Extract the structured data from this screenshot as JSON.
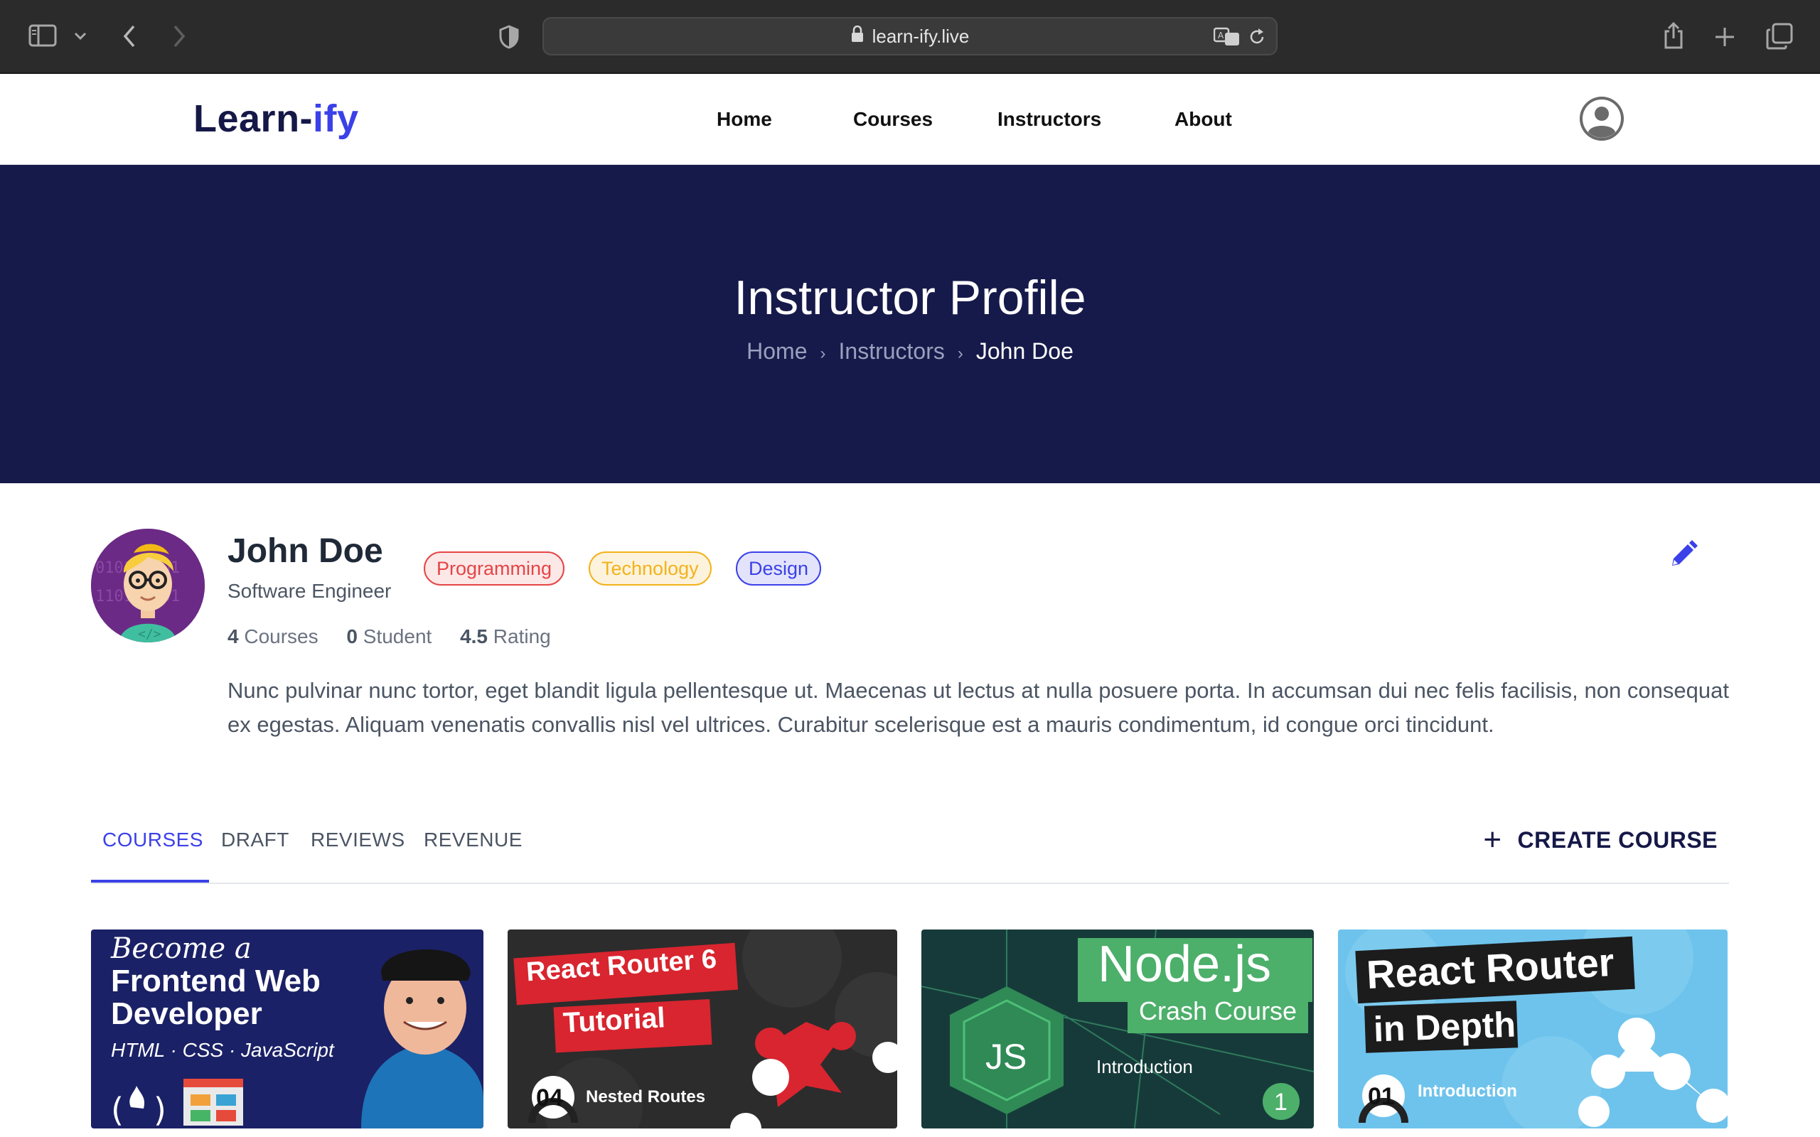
{
  "browser": {
    "url": "learn-ify.live"
  },
  "site": {
    "logo_main": "Learn-",
    "logo_accent": "ify",
    "nav": [
      "Home",
      "Courses",
      "Instructors",
      "About"
    ]
  },
  "hero": {
    "title": "Instructor Profile",
    "breadcrumb": [
      "Home",
      "Instructors",
      "John Doe"
    ]
  },
  "profile": {
    "name": "John Doe",
    "title": "Software Engineer",
    "tags": [
      {
        "label": "Programming",
        "color": "#e54545"
      },
      {
        "label": "Technology",
        "color": "#f2b21b"
      },
      {
        "label": "Design",
        "color": "#3b41e8"
      }
    ],
    "stats": {
      "courses_count": "4",
      "courses_label": "Courses",
      "students_count": "0",
      "students_label": "Student",
      "rating_value": "4.5",
      "rating_label": "Rating"
    },
    "bio": "Nunc pulvinar nunc tortor, eget blandit ligula pellentesque ut. Maecenas ut lectus at nulla posuere porta. In accumsan dui nec felis facilisis, non consequat ex egestas. Aliquam venenatis convallis nisl vel ultrices. Curabitur scelerisque est a mauris condimentum, id congue orci tincidunt."
  },
  "tabs": {
    "items": [
      "COURSES",
      "DRAFT",
      "REVIEWS",
      "REVENUE"
    ],
    "active": "COURSES",
    "create_label": "CREATE COURSE"
  },
  "courses": [
    {
      "line1": "Become a",
      "line2": "Frontend Web",
      "line3": "Developer",
      "sub": "HTML · CSS · JavaScript"
    },
    {
      "line1": "React Router 6",
      "line2": "Tutorial",
      "ep": "04",
      "ep_label": "Nested Routes"
    },
    {
      "line1": "Node.js",
      "line2": "Crash Course",
      "badge": "JS",
      "ep_label": "Introduction",
      "ep": "1"
    },
    {
      "line1": "React Router",
      "line2": "in Depth",
      "ep": "01",
      "ep_label": "Introduction"
    }
  ],
  "colors": {
    "brand": "#3b41e8",
    "hero_bg": "#161a4a",
    "dark_text": "#151847"
  }
}
